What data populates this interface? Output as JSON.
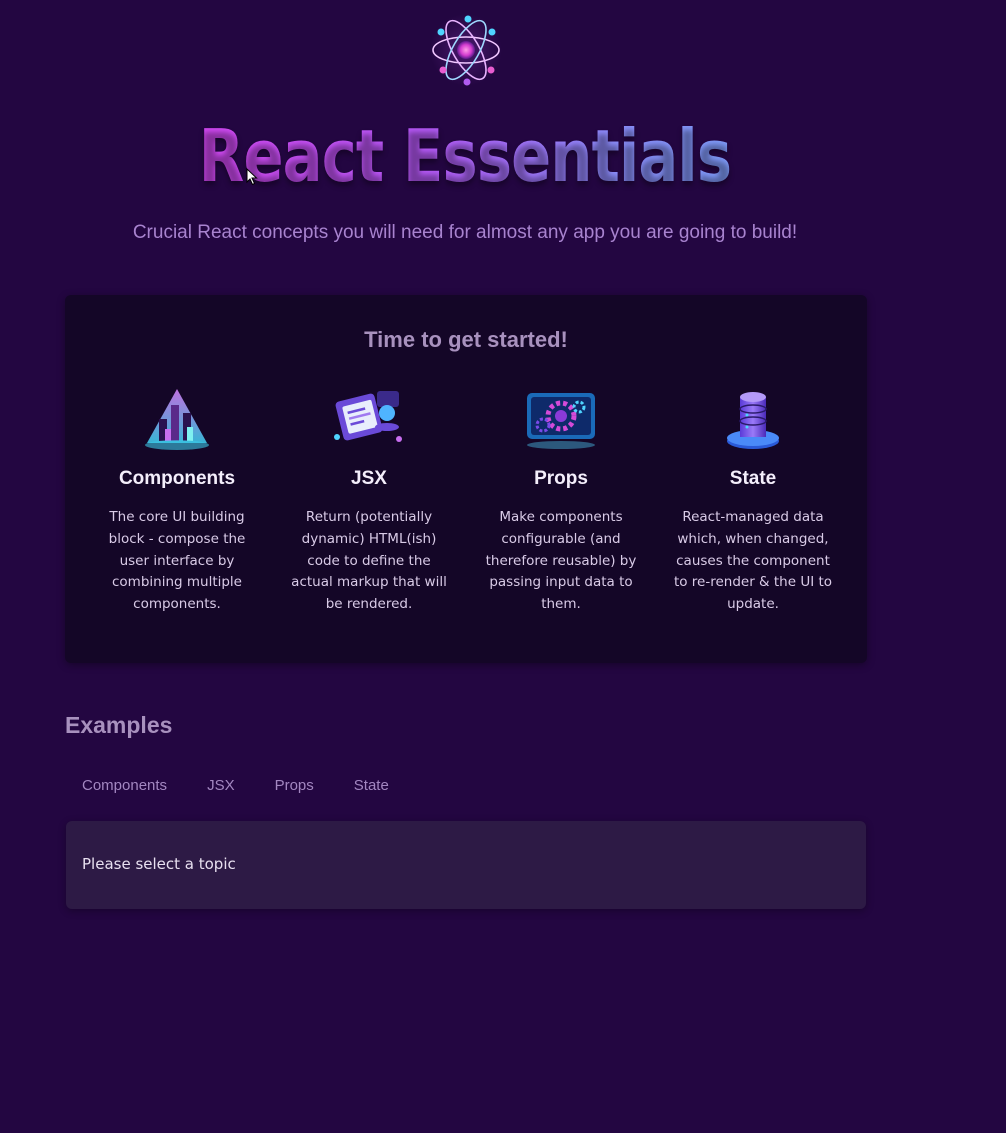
{
  "header": {
    "logo_icon": "react-atom-logo",
    "title": "React Essentials",
    "subtitle": "Crucial React concepts you will need for almost any app you are going to build!"
  },
  "core_concepts": {
    "heading": "Time to get started!",
    "items": [
      {
        "icon": "components-icon",
        "title": "Components",
        "description": "The core UI building block - compose the user interface by combining multiple components."
      },
      {
        "icon": "jsx-icon",
        "title": "JSX",
        "description": "Return (potentially dynamic) HTML(ish) code to define the actual markup that will be rendered."
      },
      {
        "icon": "props-icon",
        "title": "Props",
        "description": "Make components configurable (and therefore reusable) by passing input data to them."
      },
      {
        "icon": "state-icon",
        "title": "State",
        "description": "React-managed data which, when changed, causes the component to re-render & the UI to update."
      }
    ]
  },
  "examples": {
    "heading": "Examples",
    "tabs": [
      "Components",
      "JSX",
      "Props",
      "State"
    ],
    "placeholder": "Please select a topic"
  },
  "colors": {
    "background": "#230641",
    "panel": "#140627",
    "tab_content": "#2d1a45",
    "heading_muted": "#a891be",
    "title_gradient_start": "#e23ef0",
    "title_gradient_end": "#72aaf8"
  }
}
